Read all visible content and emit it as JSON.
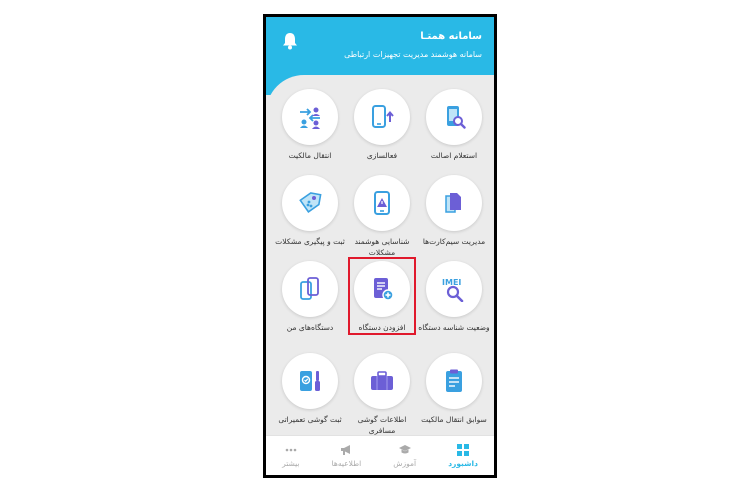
{
  "header": {
    "title": "سامانه همتـا",
    "subtitle": "سامانه هوشمند مدیریت تجهیزات ارتباطی"
  },
  "tiles": [
    {
      "label": "استعلام اصالت",
      "icon": "phone-search-icon"
    },
    {
      "label": "فعالسازی",
      "icon": "phone-upload-icon"
    },
    {
      "label": "انتقال مالکیت",
      "icon": "transfer-users-icon"
    },
    {
      "label": "مدیریت سیم‌کارت‌ها",
      "icon": "sim-cards-icon"
    },
    {
      "label": "شناسایی هوشمند مشکلات",
      "icon": "phone-warning-icon"
    },
    {
      "label": "ثبت و پیگیری مشکلات",
      "icon": "tag-icon"
    },
    {
      "label": "وضعیت شناسه دستگاه",
      "icon": "imei-search-icon"
    },
    {
      "label": "افزودن دستگاه",
      "icon": "add-device-icon"
    },
    {
      "label": "دستگاه‌های من",
      "icon": "my-devices-icon"
    },
    {
      "label": "سوابق انتقال مالکیت",
      "icon": "transfer-history-icon"
    },
    {
      "label": "اطلاعات گوشی مسافری",
      "icon": "luggage-icon"
    },
    {
      "label": "ثبت گوشی تعمیراتی",
      "icon": "repair-icon"
    }
  ],
  "nav": [
    {
      "label": "داشبورد",
      "icon": "grid-icon",
      "active": true
    },
    {
      "label": "آموزش",
      "icon": "graduation-cap-icon",
      "active": false
    },
    {
      "label": "اطلاعیه‌ها",
      "icon": "megaphone-icon",
      "active": false
    },
    {
      "label": "بیشتر",
      "icon": "more-dots-icon",
      "active": false
    }
  ],
  "colors": {
    "header": "#29b9e6",
    "icon_blue": "#3aa0e0",
    "icon_purple": "#6c5fd6",
    "highlight": "#e0192c"
  }
}
